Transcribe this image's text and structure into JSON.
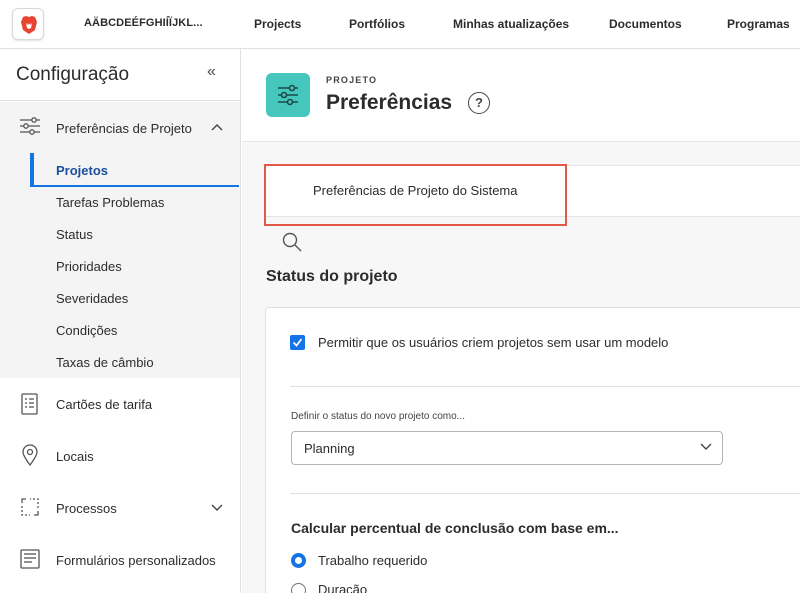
{
  "topbar": {
    "org_name": "AÄBCDEÉFGHIÍÏJKL...",
    "nav": [
      "Projects",
      "Portfólios",
      "Minhas atualizações",
      "Documentos",
      "Programas"
    ]
  },
  "sidebar": {
    "title": "Configuração",
    "collapse_icon": "«",
    "group": {
      "label": "Preferências de Projeto",
      "items": [
        "Projetos",
        "Tarefas Problemas",
        "Status",
        "Prioridades",
        "Severidades",
        "Condições",
        "Taxas de câmbio"
      ],
      "active_index": 0
    },
    "items": [
      {
        "label": "Cartões de tarifa",
        "icon": "rate-card-icon"
      },
      {
        "label": "Locais",
        "icon": "location-pin-icon"
      },
      {
        "label": "Processos",
        "icon": "process-icon"
      },
      {
        "label": "Formulários personalizados",
        "icon": "form-icon"
      }
    ]
  },
  "header": {
    "eyebrow": "PROJETO",
    "title": "Preferências",
    "help": "?"
  },
  "search": {
    "value": "Preferências de Projeto do Sistema"
  },
  "section": {
    "title": "Status do projeto",
    "allow_without_template": {
      "label": "Permitir que os usuários criem projetos sem usar um modelo",
      "checked": true
    },
    "new_status": {
      "label": "Definir o status do novo projeto como...",
      "value": "Planning"
    },
    "calc": {
      "title": "Calcular percentual de conclusão com base em...",
      "options": [
        "Trabalho requerido",
        "Duração"
      ],
      "selected_index": 0
    }
  },
  "colors": {
    "accent": "#1473e6",
    "page_icon": "#46c7be",
    "highlight": "#e05a47"
  }
}
